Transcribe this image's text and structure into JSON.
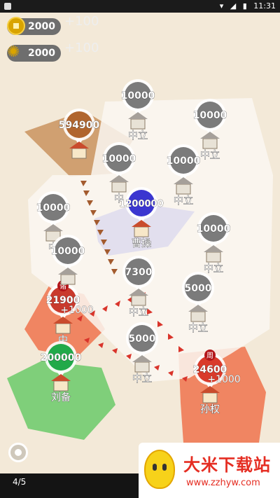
{
  "status_bar": {
    "time": "11:31"
  },
  "resources": {
    "gold": {
      "value": "2000",
      "plus": "+100",
      "icon": "coin-icon"
    },
    "food": {
      "value": "2000",
      "plus": "+100",
      "icon": "wheat-icon"
    }
  },
  "colors": {
    "background": "#f3e9d8",
    "neutral_badge": "#7b7b7b",
    "yellow_lord": "#b07d4f",
    "blue_lord": "#5b5bd8",
    "red_lord": "#ef6a4a",
    "green_lord": "#7fcf7a",
    "arrow": "#d9342b"
  },
  "nodes": [
    {
      "id": "yellow-lord",
      "troops": "594900",
      "label": "",
      "faction": "yellow"
    },
    {
      "id": "cao-cao",
      "troops": "1200000",
      "label": "曹操",
      "faction": "blue"
    },
    {
      "id": "zhuge",
      "troops": "21900",
      "bonus": "+1000",
      "label": "中",
      "badge": "诸",
      "faction": "red"
    },
    {
      "id": "liu-bei",
      "troops": "200000",
      "label": "刘备",
      "faction": "green"
    },
    {
      "id": "sun-quan",
      "troops": "24600",
      "bonus": "+1000",
      "label": "孙权",
      "badge": "周",
      "faction": "red"
    },
    {
      "id": "n1",
      "troops": "10000",
      "label": "中立",
      "faction": "neutral"
    },
    {
      "id": "n2",
      "troops": "10000",
      "label": "中立",
      "faction": "neutral"
    },
    {
      "id": "n3",
      "troops": "10000",
      "label": "中",
      "faction": "neutral"
    },
    {
      "id": "n4",
      "troops": "10000",
      "label": "中立",
      "faction": "neutral"
    },
    {
      "id": "n5",
      "troops": "10000",
      "label": "中",
      "faction": "neutral"
    },
    {
      "id": "n6",
      "troops": "10000",
      "label": "",
      "faction": "neutral"
    },
    {
      "id": "n7",
      "troops": "10000",
      "label": "中立",
      "faction": "neutral"
    },
    {
      "id": "n8",
      "troops": "7300",
      "label": "中立",
      "faction": "neutral"
    },
    {
      "id": "n9",
      "troops": "5000",
      "label": "中立",
      "faction": "neutral"
    },
    {
      "id": "n10",
      "troops": "5000",
      "label": "中立",
      "faction": "neutral"
    }
  ],
  "level": "4/5",
  "watermark": {
    "title": "大米下载站",
    "url": "www.zzhyw.com"
  }
}
